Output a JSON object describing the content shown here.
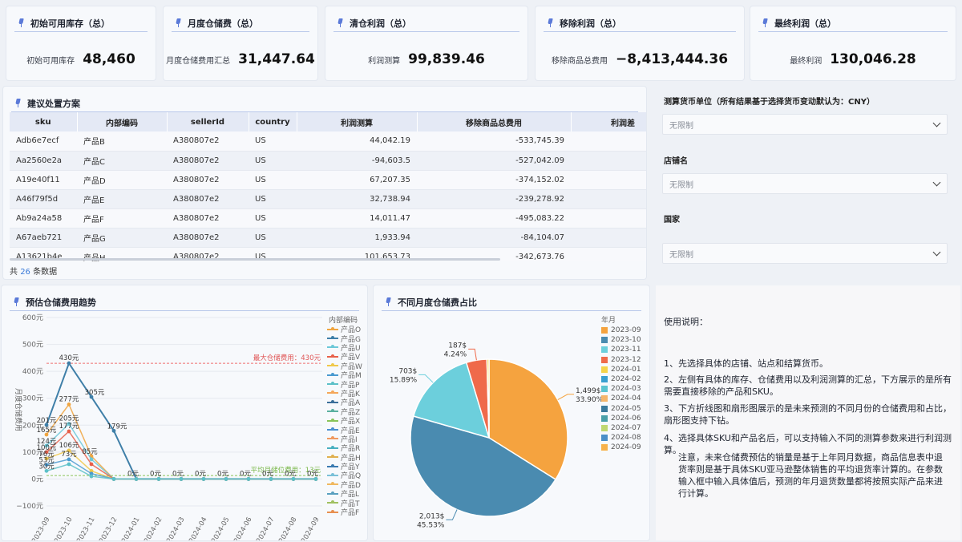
{
  "kpis": [
    {
      "title": "初始可用库存（总）",
      "label": "初始可用库存",
      "value": "48,460"
    },
    {
      "title": "月度仓储费（总）",
      "label": "月度仓储费用汇总",
      "value": "31,447.64"
    },
    {
      "title": "清仓利润（总）",
      "label": "利润测算",
      "value": "99,839.46"
    },
    {
      "title": "移除利润（总）",
      "label": "移除商品总费用",
      "value": "−8,413,444.36"
    },
    {
      "title": "最终利润（总）",
      "label": "最终利润",
      "value": "130,046.28"
    }
  ],
  "table": {
    "title": "建议处置方案",
    "headers": [
      "sku",
      "内部编码",
      "sellerId",
      "country",
      "利润测算",
      "移除商品总费用",
      "利润差"
    ],
    "rows": [
      [
        "Adb6e7ecf",
        "产品B",
        "A380807e2",
        "US",
        "44,042.19",
        "-533,745.39"
      ],
      [
        "Aa2560e2a",
        "产品C",
        "A380807e2",
        "US",
        "-94,603.5",
        "-527,042.09"
      ],
      [
        "A19e40f11",
        "产品D",
        "A380807e2",
        "US",
        "67,207.35",
        "-374,152.02"
      ],
      [
        "A46f79f5d",
        "产品E",
        "A380807e2",
        "US",
        "32,738.94",
        "-239,278.92"
      ],
      [
        "Ab9a24a58",
        "产品F",
        "A380807e2",
        "US",
        "14,011.47",
        "-495,083.22"
      ],
      [
        "A67aeb721",
        "产品G",
        "A380807e2",
        "US",
        "1,933.94",
        "-84,104.07"
      ],
      [
        "A13621b4e",
        "产品H",
        "A380807e2",
        "US",
        "101,653.73",
        "-342,673.76"
      ]
    ],
    "footer_prefix": "共",
    "footer_count": "26",
    "footer_suffix": "条数据"
  },
  "filters": {
    "currency_label": "测算货币单位（所有结果基于选择货币变动默认为：CNY）",
    "currency_value": "无限制",
    "store_label": "店铺名",
    "store_value": "无限制",
    "country_label": "国家",
    "country_value": "无限制"
  },
  "line_card": {
    "title": "预估仓储费用趋势",
    "legend_title": "内部编码",
    "legend": [
      "产品O",
      "产品G",
      "产品U",
      "产品V",
      "产品W",
      "产品M",
      "产品P",
      "产品K",
      "产品A",
      "产品Z",
      "产品X",
      "产品E",
      "产品I",
      "产品R",
      "产品H",
      "产品Y",
      "产品Q",
      "产品D",
      "产品L",
      "产品T",
      "产品F"
    ],
    "legend_colors": [
      "#f0a540",
      "#3f7fa8",
      "#6cc8d8",
      "#e8604a",
      "#f0c84a",
      "#4a9ad0",
      "#5cc0c8",
      "#f5a75a",
      "#3b6f9a",
      "#5ab0a0",
      "#8ac45a",
      "#4a8fd0",
      "#f09a60",
      "#4ab0c0",
      "#e0b050",
      "#3a7ab0",
      "#7ac0d8",
      "#f0b860",
      "#5aa0c0",
      "#a0c060",
      "#e89050"
    ],
    "max_label": "最大仓储费用：430元",
    "avg_label": "平均月储位费用：13元"
  },
  "chart_data": [
    {
      "type": "line",
      "title": "预估仓储费用趋势",
      "ylabel": "月度仓储费用",
      "ylim": [
        -100,
        600
      ],
      "yticks": [
        "600元",
        "500元",
        "400元",
        "300元",
        "200元",
        "100元",
        "0元",
        "−100元"
      ],
      "x": [
        "2023-09",
        "2023-10",
        "2023-11",
        "2023-12",
        "2024-01",
        "2024-02",
        "2024-03",
        "2024-04",
        "2024-05",
        "2024-06",
        "2024-07",
        "2024-08",
        "2024-09"
      ],
      "series": [
        {
          "name": "产品G",
          "values": [
            201,
            430,
            305,
            179,
            0,
            0,
            0,
            0,
            0,
            0,
            0,
            0,
            0
          ]
        },
        {
          "name": "产品O",
          "values": [
            165,
            277,
            85,
            0,
            0,
            0,
            0,
            0,
            0,
            0,
            0,
            0,
            0
          ]
        },
        {
          "name": "产品U",
          "values": [
            124,
            205,
            73,
            0,
            0,
            0,
            0,
            0,
            0,
            0,
            0,
            0,
            0
          ]
        },
        {
          "name": "产品V",
          "values": [
            100,
            177,
            55,
            0,
            0,
            0,
            0,
            0,
            0,
            0,
            0,
            0,
            0
          ]
        },
        {
          "name": "产品W",
          "values": [
            76,
            106,
            30,
            0,
            0,
            0,
            0,
            0,
            0,
            0,
            0,
            0,
            0
          ]
        },
        {
          "name": "产品M",
          "values": [
            53,
            73,
            20,
            0,
            0,
            0,
            0,
            0,
            0,
            0,
            0,
            0,
            0
          ]
        },
        {
          "name": "产品P",
          "values": [
            30,
            55,
            10,
            0,
            0,
            0,
            0,
            0,
            0,
            0,
            0,
            0,
            0
          ]
        }
      ],
      "data_labels": [
        "201元",
        "165元",
        "124元",
        "100元",
        "76元",
        "53元",
        "30元",
        "430元",
        "277元",
        "205元",
        "177元",
        "106元",
        "73元",
        "85元",
        "305元",
        "179元",
        "0元",
        "0元",
        "0元",
        "0元",
        "0元",
        "0元",
        "0元",
        "0元",
        "0元"
      ],
      "reference_lines": [
        {
          "name": "最大仓储费用",
          "value": 430
        },
        {
          "name": "平均月储位费用",
          "value": 13
        }
      ]
    },
    {
      "type": "pie",
      "title": "不同月度仓储费占比",
      "legend_title": "年月",
      "legend": [
        "2023-09",
        "2023-10",
        "2023-11",
        "2023-12",
        "2024-01",
        "2024-02",
        "2024-03",
        "2024-04",
        "2024-05",
        "2024-06",
        "2024-07",
        "2024-08",
        "2024-09"
      ],
      "colors": [
        "#f5a33f",
        "#4a8bb0",
        "#6ccfdc",
        "#ef6a4a",
        "#f5d34a",
        "#3a9fd0",
        "#5cc4d0",
        "#f5b56a",
        "#3b7a9c",
        "#4aa0a8",
        "#c0d870",
        "#4a8fc8",
        "#f7b24a"
      ],
      "slices": [
        {
          "name": "2023-09",
          "value": 1499,
          "label": "1,499$",
          "pct": "33.90%"
        },
        {
          "name": "2023-10",
          "value": 2013,
          "label": "2,013$",
          "pct": "45.53%"
        },
        {
          "name": "2023-11",
          "value": 703,
          "label": "703$",
          "pct": "15.89%"
        },
        {
          "name": "2023-12",
          "value": 187,
          "label": "187$",
          "pct": "4.24%"
        },
        {
          "name": "2024-01",
          "value": 19,
          "label": "",
          "pct": ""
        }
      ]
    }
  ],
  "help": {
    "title": "使用说明：",
    "p1": "1、先选择具体的店铺、站点和结算货币。",
    "p2": "2、左侧有具体的库存、仓储费用以及利润测算的汇总，下方展示的是所有需要直接移除的产品和SKU。",
    "p3": "3、下方折线图和扇形图展示的是未来预测的不同月份的仓储费用和占比，扇形图支持下钻。",
    "p4": "4、选择具体SKU和产品名后，可以支持输入不同的测算参数来进行利润测算。",
    "note": "注意，未来仓储费预估的销量是基于上年同月数据，商品信息表中退货率则是基于具体SKU亚马逊整体销售的平均退货率计算的。在参数输入框中输入具体值后，预测的年月退货数量都将按照实际产品来进行计算。"
  }
}
